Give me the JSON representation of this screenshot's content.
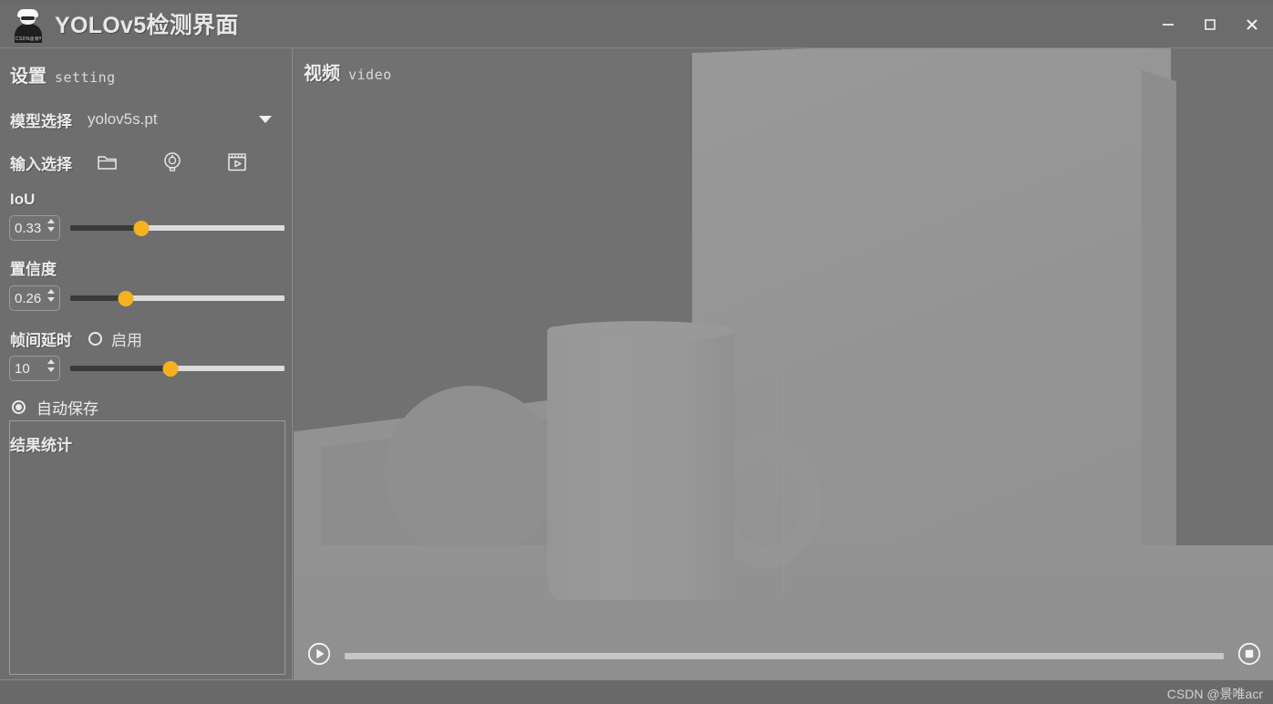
{
  "titlebar": {
    "app_title": "YOLOv5检测界面",
    "logo_nick": "CSDN@景唯acr",
    "minimize_label": "minimize-icon",
    "maximize_label": "maximize-icon",
    "close_label": "close-icon"
  },
  "sidebar": {
    "section_title_zh": "设置",
    "section_title_en": "setting",
    "model": {
      "label": "模型选择",
      "value": "yolov5s.pt",
      "options": [
        "yolov5s.pt"
      ]
    },
    "input": {
      "label": "输入选择",
      "icons": [
        "folder-icon",
        "camera-icon",
        "video-icon"
      ]
    },
    "iou": {
      "label": "IoU",
      "value": "0.33",
      "percent": 33
    },
    "confidence": {
      "label": "置信度",
      "value": "0.26",
      "percent": 26
    },
    "frame_delay": {
      "label": "帧间延时",
      "enable_label": "启用",
      "enabled": false,
      "value": "10",
      "percent": 47
    },
    "autosave": {
      "label": "自动保存",
      "checked": true
    },
    "stats": {
      "label": "结果统计",
      "content": ""
    }
  },
  "video": {
    "title_zh": "视频",
    "title_en": "video",
    "play_label": "play-icon",
    "stop_label": "stop-icon",
    "progress_percent": 0
  },
  "statusbar": {
    "watermark": "CSDN @景唯acr"
  },
  "colors": {
    "accent": "#f5b120",
    "window_bg": "#6e6e6e",
    "panel_bg": "#717171",
    "track": "#dcdcdc",
    "track_fill": "#3a3a3a",
    "text": "#ededed"
  }
}
